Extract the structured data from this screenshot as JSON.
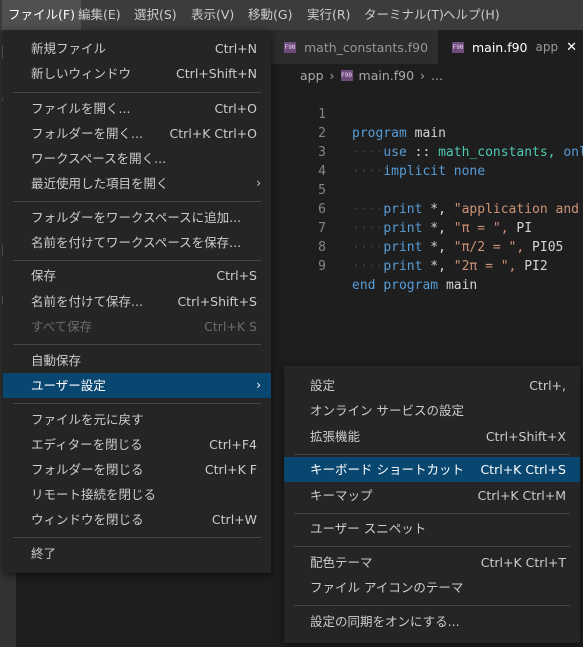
{
  "menubar": {
    "items": [
      "ファイル(F)",
      "編集(E)",
      "選択(S)",
      "表示(V)",
      "移動(G)",
      "実行(R)",
      "ターミナル(T)",
      "ヘルプ(H)"
    ]
  },
  "tabs": [
    {
      "icon": "f90-file-icon",
      "file_badge": "F90",
      "label": "math_constants.f90"
    },
    {
      "icon": "f90-file-icon",
      "file_badge": "F90",
      "label": "main.f90",
      "hint": "app",
      "close": "✕"
    }
  ],
  "breadcrumb": {
    "folder": "app",
    "file": "main.f90",
    "more": "..."
  },
  "editor": {
    "lines": [
      {
        "n": "1"
      },
      {
        "n": "2"
      },
      {
        "n": "3"
      },
      {
        "n": "4"
      },
      {
        "n": "5"
      },
      {
        "n": "6"
      },
      {
        "n": "7"
      },
      {
        "n": "8"
      },
      {
        "n": "9"
      }
    ],
    "tokens": {
      "program": "program",
      "main": "main",
      "use": "use",
      "colons": "::",
      "module": "math_constants,",
      "only": "onl",
      "implicit": "implicit",
      "none": "none",
      "print": "print",
      "star": "*,",
      "s1": "\"application and",
      "s2": "\"π = \",",
      "v2": "PI",
      "s3": "\"π/2 = \",",
      "v3": "PI05",
      "s4": "\"2π = \",",
      "v4": "PI2",
      "end": "end",
      "program2": "program",
      "main2": "main"
    }
  },
  "file_menu": {
    "items": [
      {
        "label": "新規ファイル",
        "key": "Ctrl+N"
      },
      {
        "label": "新しいウィンドウ",
        "key": "Ctrl+Shift+N"
      },
      {
        "label": "ファイルを開く...",
        "key": "Ctrl+O"
      },
      {
        "label": "フォルダーを開く...",
        "key": "Ctrl+K Ctrl+O"
      },
      {
        "label": "ワークスペースを開く...",
        "key": ""
      },
      {
        "label": "最近使用した項目を開く",
        "key": "",
        "chevron": "›"
      },
      {
        "label": "フォルダーをワークスペースに追加...",
        "key": ""
      },
      {
        "label": "名前を付けてワークスペースを保存...",
        "key": ""
      },
      {
        "label": "保存",
        "key": "Ctrl+S"
      },
      {
        "label": "名前を付けて保存...",
        "key": "Ctrl+Shift+S"
      },
      {
        "label": "すべて保存",
        "key": "Ctrl+K S"
      },
      {
        "label": "自動保存",
        "key": ""
      },
      {
        "label": "ユーザー設定",
        "key": "",
        "chevron": "›"
      },
      {
        "label": "ファイルを元に戻す",
        "key": ""
      },
      {
        "label": "エディターを閉じる",
        "key": "Ctrl+F4"
      },
      {
        "label": "フォルダーを閉じる",
        "key": "Ctrl+K F"
      },
      {
        "label": "リモート接続を閉じる",
        "key": ""
      },
      {
        "label": "ウィンドウを閉じる",
        "key": "Ctrl+W"
      },
      {
        "label": "終了",
        "key": ""
      }
    ]
  },
  "prefs_menu": {
    "items": [
      {
        "label": "設定",
        "key": "Ctrl+,"
      },
      {
        "label": "オンライン サービスの設定",
        "key": ""
      },
      {
        "label": "拡張機能",
        "key": "Ctrl+Shift+X"
      },
      {
        "label": "キーボード ショートカット",
        "key": "Ctrl+K Ctrl+S"
      },
      {
        "label": "キーマップ",
        "key": "Ctrl+K Ctrl+M"
      },
      {
        "label": "ユーザー スニペット",
        "key": ""
      },
      {
        "label": "配色テーマ",
        "key": "Ctrl+K Ctrl+T"
      },
      {
        "label": "ファイル アイコンのテーマ",
        "key": ""
      },
      {
        "label": "設定の同期をオンにする...",
        "key": ""
      }
    ]
  },
  "colors": {
    "accent": "#094771",
    "menu_bg": "#252526",
    "editor_bg": "#1e1e1e"
  }
}
